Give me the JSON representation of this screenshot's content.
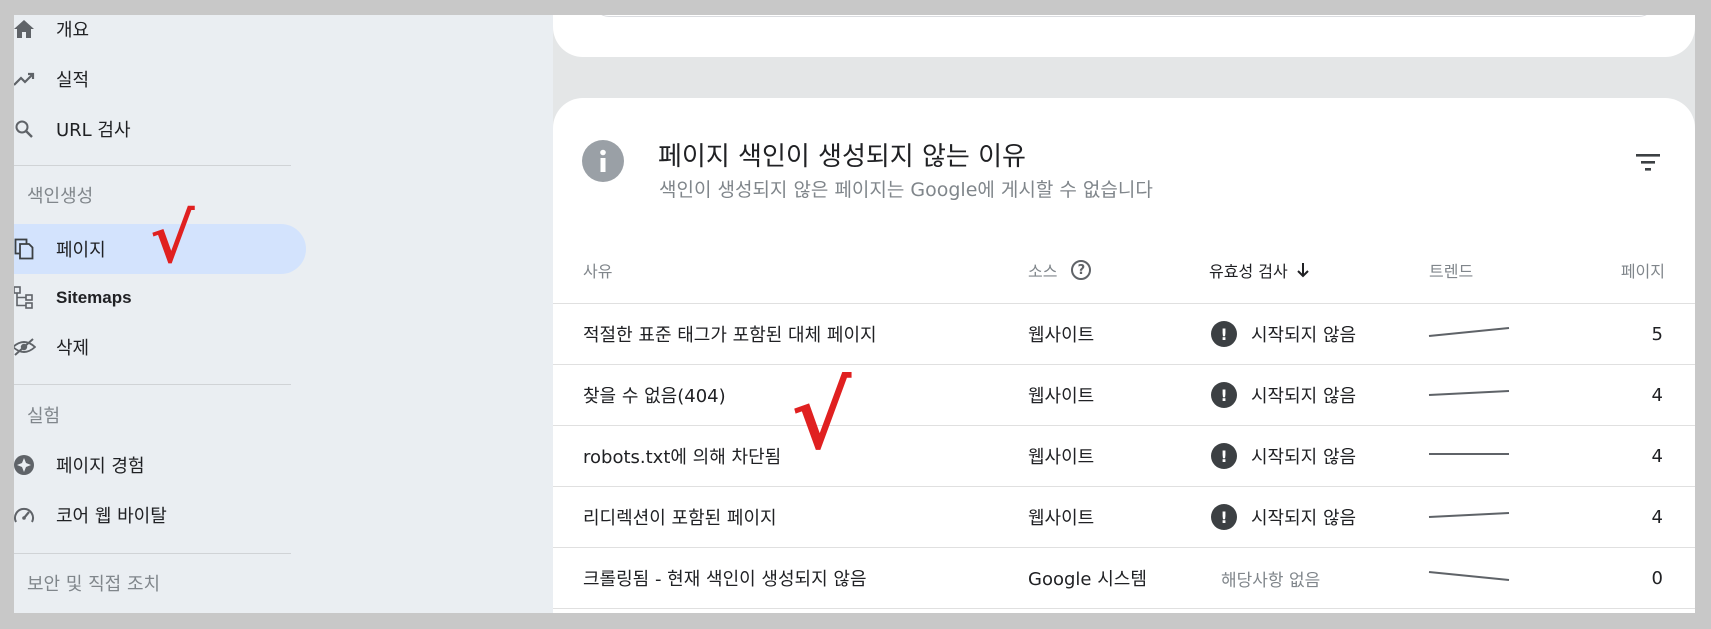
{
  "sidebar": {
    "items": [
      {
        "label": "개요",
        "icon": "home-icon"
      },
      {
        "label": "실적",
        "icon": "trending-up-icon"
      },
      {
        "label": "URL 검사",
        "icon": "search-icon"
      }
    ],
    "indexing": {
      "header": "색인생성",
      "items": [
        {
          "label": "페이지",
          "icon": "pages-icon",
          "active": true
        },
        {
          "label": "Sitemaps",
          "icon": "sitemap-icon"
        },
        {
          "label": "삭제",
          "icon": "removals-icon"
        }
      ]
    },
    "experiments": {
      "header": "실험",
      "items": [
        {
          "label": "페이지 경험",
          "icon": "page-experience-icon"
        },
        {
          "label": "코어 웹 바이탈",
          "icon": "speed-gauge-icon"
        }
      ]
    },
    "security_header": "보안 및 직접 조치"
  },
  "card": {
    "title": "페이지 색인이 생성되지 않는 이유",
    "subtitle": "색인이 생성되지 않은 페이지는 Google에 게시할 수 없습니다",
    "columns": {
      "reason": "사유",
      "source": "소스",
      "validation": "유효성 검사",
      "trend": "트렌드",
      "pages": "페이지"
    },
    "rows": [
      {
        "reason": "적절한 표준 태그가 포함된 대체 페이지",
        "source": "웹사이트",
        "validation": "시작되지 않음",
        "pages": "5"
      },
      {
        "reason": "찾을 수 없음(404)",
        "source": "웹사이트",
        "validation": "시작되지 않음",
        "pages": "4"
      },
      {
        "reason": "robots.txt에 의해 차단됨",
        "source": "웹사이트",
        "validation": "시작되지 않음",
        "pages": "4"
      },
      {
        "reason": "리디렉션이 포함된 페이지",
        "source": "웹사이트",
        "validation": "시작되지 않음",
        "pages": "4"
      },
      {
        "reason": "크롤링됨 - 현재 색인이 생성되지 않음",
        "source": "Google 시스템",
        "validation": "해당사항 없음",
        "pages": "0"
      }
    ]
  },
  "annotations": {
    "mark": "√",
    "color": "#e02020"
  },
  "colors": {
    "active_nav": "#d3e3fd",
    "sidebar_bg": "#eaeef2",
    "card_bg": "#ffffff",
    "badge": "#3c4043"
  }
}
